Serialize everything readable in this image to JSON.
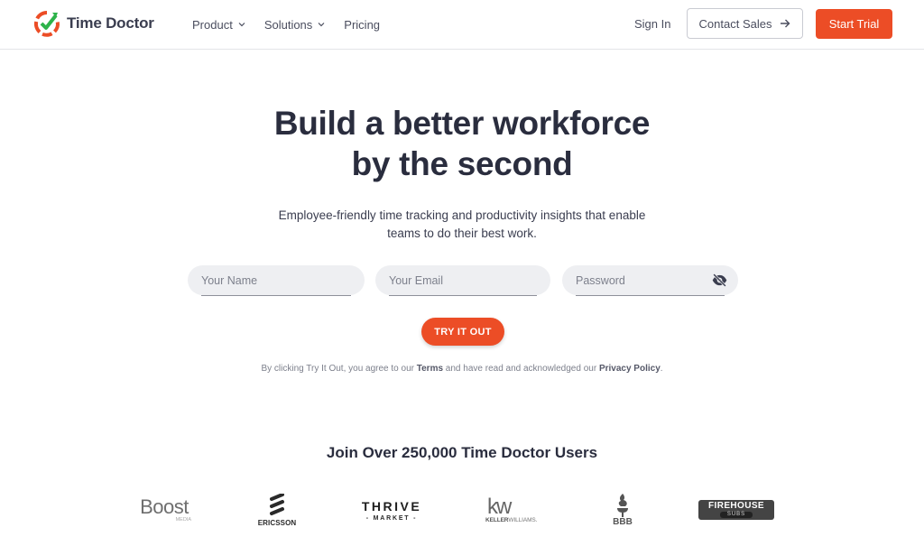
{
  "header": {
    "brand": "Time Doctor",
    "nav": [
      {
        "label": "Product",
        "has_dropdown": true
      },
      {
        "label": "Solutions",
        "has_dropdown": true
      },
      {
        "label": "Pricing",
        "has_dropdown": false
      }
    ],
    "sign_in": "Sign In",
    "contact_sales": "Contact Sales",
    "start_trial": "Start Trial"
  },
  "hero": {
    "title_line1": "Build a better workforce",
    "title_line2": "by the second",
    "subtitle_line1": "Employee-friendly time tracking and productivity insights that enable",
    "subtitle_line2": "teams to do their best work."
  },
  "form": {
    "name": {
      "value": "",
      "placeholder": "Your Name"
    },
    "email": {
      "value": "",
      "placeholder": "Your Email"
    },
    "password": {
      "value": "",
      "placeholder": "Password",
      "visibility_icon": "eye-off-icon"
    },
    "submit": "TRY IT OUT",
    "legal": {
      "prefix": "By clicking Try It Out, you agree to our ",
      "terms": "Terms",
      "middle": " and have read and acknowledged our ",
      "privacy": "Privacy Policy",
      "suffix": "."
    }
  },
  "social_proof": {
    "heading": "Join Over 250,000 Time Doctor Users",
    "logos": {
      "boost": {
        "main": "Boost",
        "sub": "MEDIA"
      },
      "ericsson": {
        "name": "ERICSSON"
      },
      "thrive": {
        "main": "THRIVE",
        "sub": "- MARKET -"
      },
      "keller": {
        "main": "kw",
        "sub_bold": "KELLER",
        "sub_light": "WILLIAMS."
      },
      "bbb": {
        "name": "BBB"
      },
      "firehouse": {
        "main": "FIREHOUSE",
        "sub": "SUBS"
      }
    }
  },
  "colors": {
    "accent": "#ec4d26",
    "logo_green": "#2db34a",
    "text_dark": "#2a2d3e",
    "field_bg": "#eeeff2"
  }
}
